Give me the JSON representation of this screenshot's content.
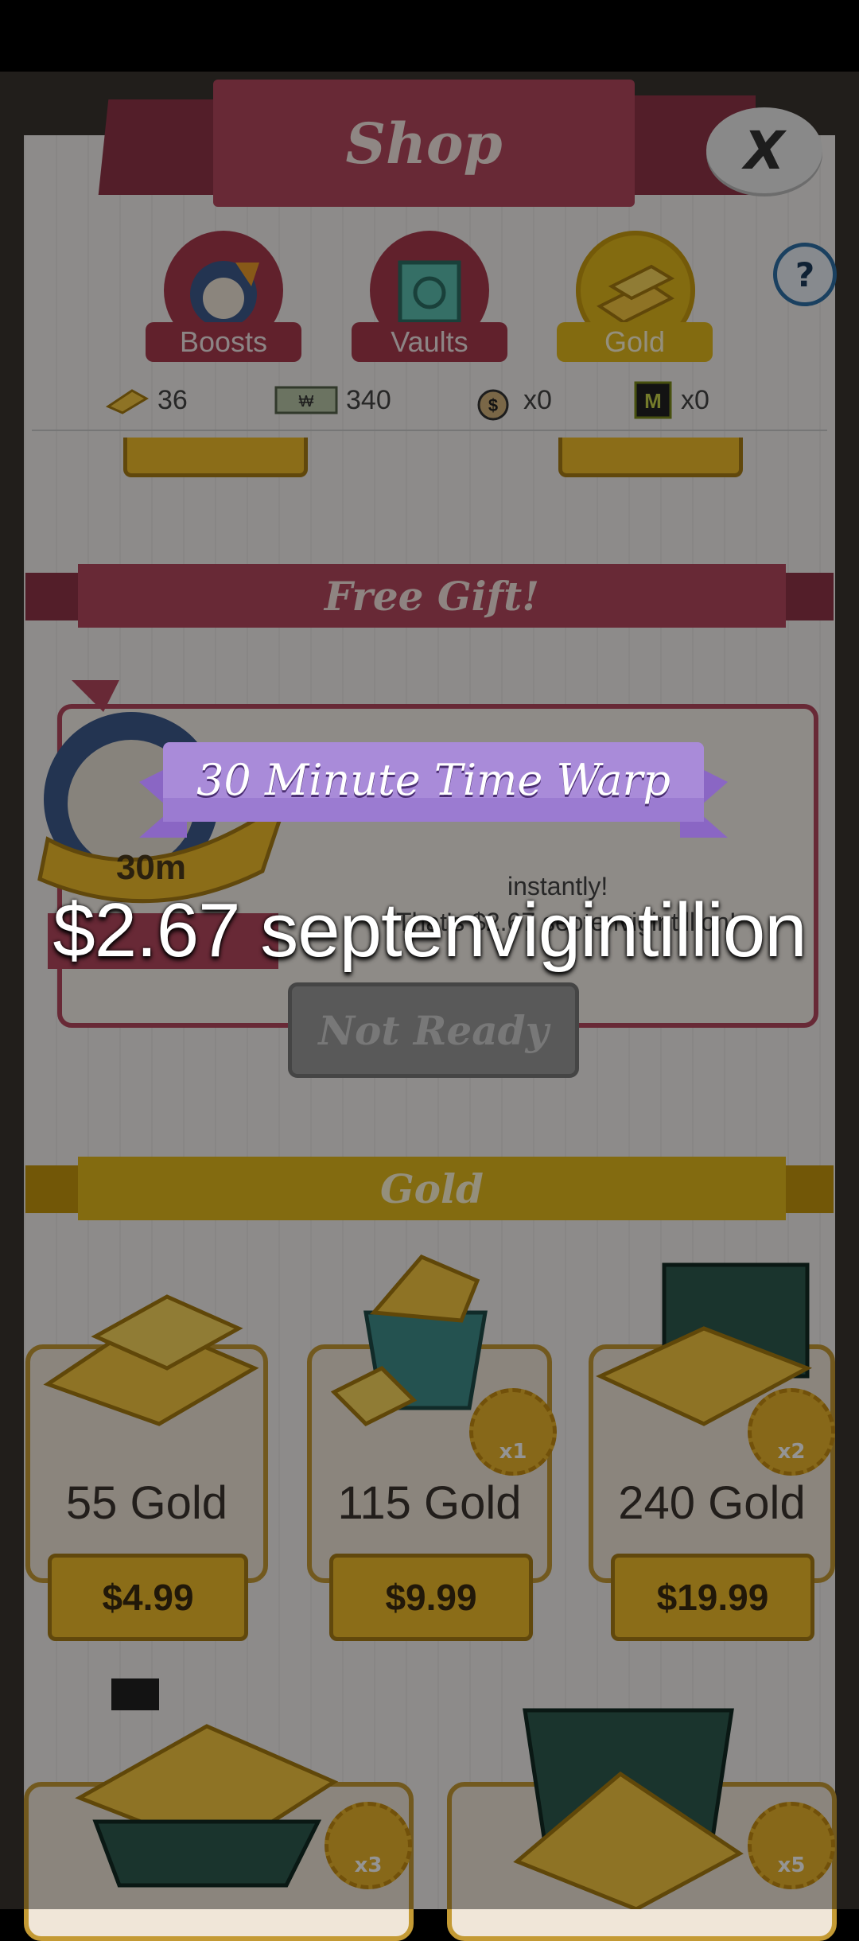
{
  "shop": {
    "title": "Shop",
    "close_label": "X",
    "help_label": "?",
    "tabs": [
      {
        "label": "Boosts",
        "icon": "boost-bag-icon"
      },
      {
        "label": "Vaults",
        "icon": "vault-icon"
      },
      {
        "label": "Gold",
        "icon": "gold-bars-icon",
        "selected": true
      }
    ],
    "currencies": [
      {
        "icon": "gold-icon",
        "value": "36"
      },
      {
        "icon": "megabucks-icon",
        "value": "340"
      },
      {
        "icon": "money-bag-icon",
        "value": "x0"
      },
      {
        "icon": "mega-ticket-icon",
        "value": "x0"
      }
    ]
  },
  "free_gift": {
    "banner": "Free Gift!",
    "button_label": "Not Ready",
    "desc_line1": "instantly!",
    "desc_line2": "That's $2.67 septenvigintillion!",
    "icon_label": "30m"
  },
  "gold_section": {
    "banner": "Gold",
    "items": [
      {
        "amount": "55 Gold",
        "price": "$4.99",
        "badge": ""
      },
      {
        "amount": "115 Gold",
        "price": "$9.99",
        "badge": "x1"
      },
      {
        "amount": "240 Gold",
        "price": "$19.99",
        "badge": "x2"
      },
      {
        "amount": "",
        "price": "",
        "badge": "x3"
      },
      {
        "amount": "",
        "price": "",
        "badge": "x5"
      }
    ]
  },
  "reward_popup": {
    "title": "30 Minute Time Warp",
    "amount": "$2.67 septenvigintillion"
  },
  "colors": {
    "shop_red": "#b3485d",
    "gold": "#f0bc2a",
    "ribbon_purple": "#9b7bd1"
  }
}
